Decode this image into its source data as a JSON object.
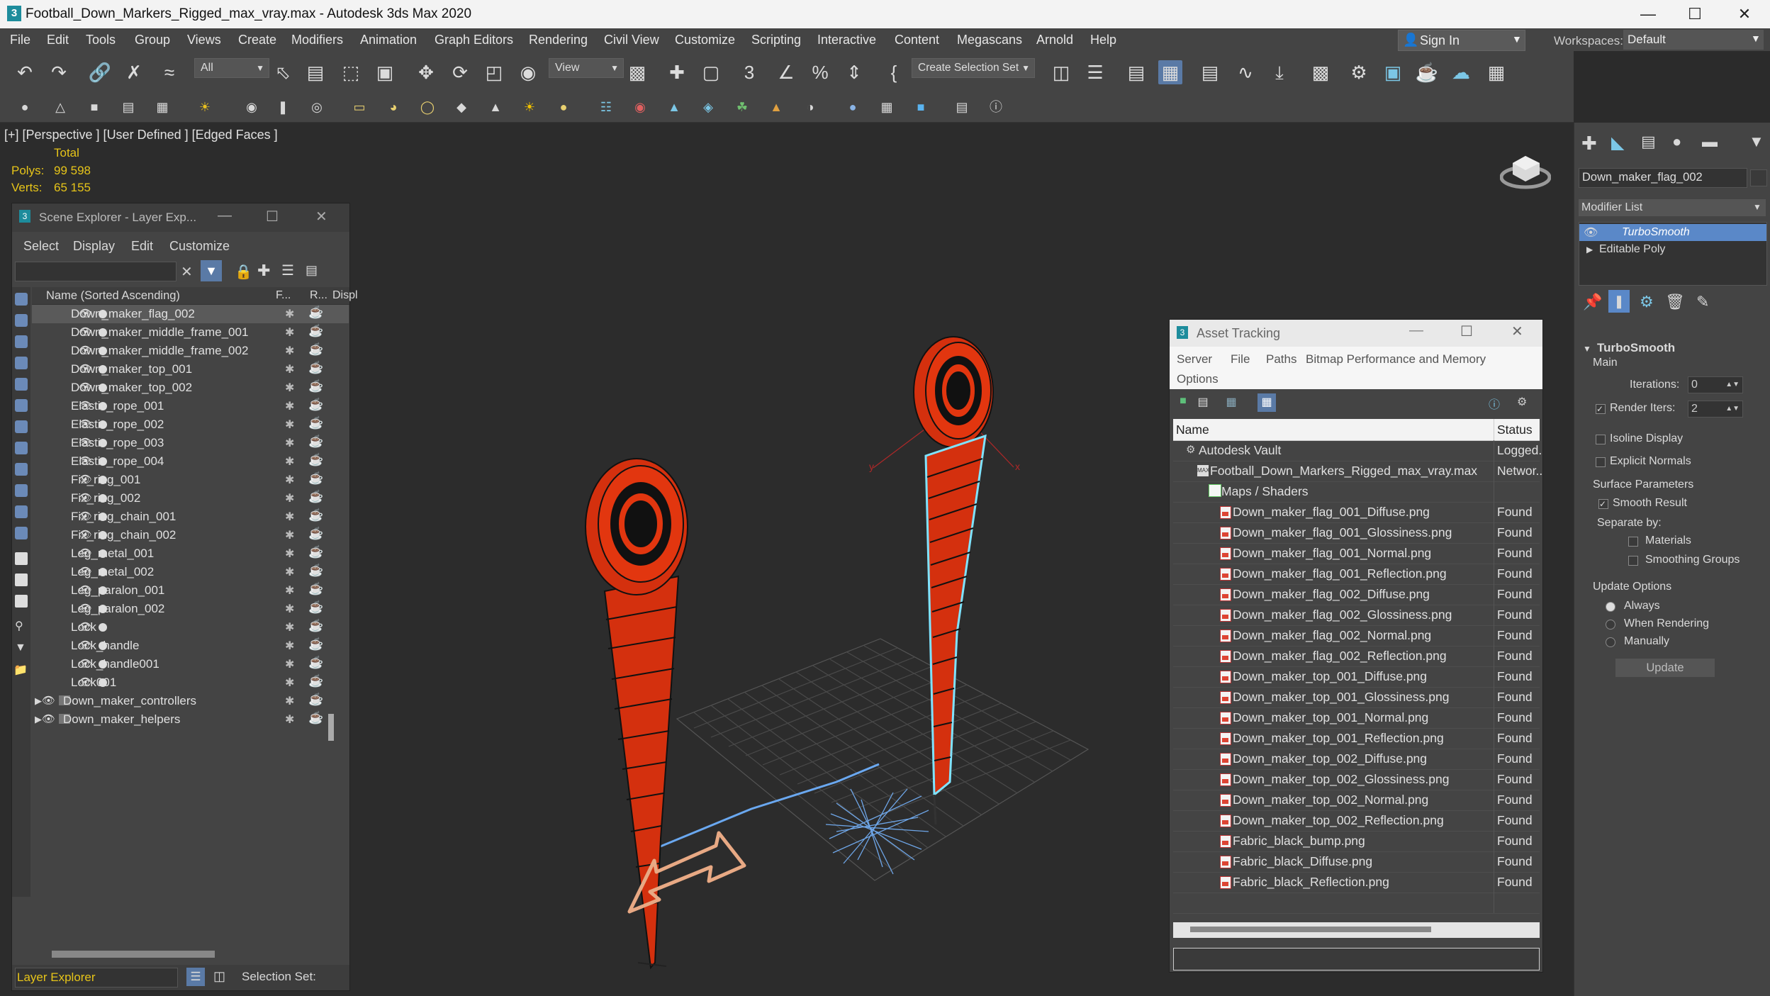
{
  "app": {
    "title": "Football_Down_Markers_Rigged_max_vray.max - Autodesk 3ds Max 2020",
    "icon": "3"
  },
  "menu": [
    "File",
    "Edit",
    "Tools",
    "Group",
    "Views",
    "Create",
    "Modifiers",
    "Animation",
    "Graph Editors",
    "Rendering",
    "Civil View",
    "Customize",
    "Scripting",
    "Interactive",
    "Content",
    "Megascans",
    "Arnold",
    "Help"
  ],
  "account": {
    "sign_in": "Sign In",
    "workspaces_label": "Workspaces:",
    "workspace": "Default"
  },
  "toolbar": {
    "filter": "All",
    "ref_coord": "View",
    "selection_set": "Create Selection Set"
  },
  "viewport": {
    "label": "[+] [Perspective ] [User Defined ] [Edged Faces ]",
    "stats_header": "Total",
    "polys_label": "Polys:",
    "polys": "99 598",
    "verts_label": "Verts:",
    "verts": "65 155",
    "colors": {
      "flag": "#d4300e",
      "target": "#e2360f",
      "grid": "#4a4a4a",
      "select": "#7fe3ff",
      "helper": "#e8a984"
    }
  },
  "scene_explorer": {
    "title": "Scene Explorer - Layer Exp...",
    "menu": [
      "Select",
      "Display",
      "Edit",
      "Customize"
    ],
    "col_name": "Name (Sorted Ascending)",
    "col_f": "F...",
    "col_r": "R...",
    "col_d": "Displ",
    "items": [
      {
        "name": "Down_maker_flag_002",
        "selected": true
      },
      {
        "name": "Down_maker_middle_frame_001"
      },
      {
        "name": "Down_maker_middle_frame_002"
      },
      {
        "name": "Down_maker_top_001"
      },
      {
        "name": "Down_maker_top_002"
      },
      {
        "name": "Elastic_rope_001"
      },
      {
        "name": "Elastic_rope_002"
      },
      {
        "name": "Elastic_rope_003"
      },
      {
        "name": "Elastic_rope_004"
      },
      {
        "name": "Fix_ring_001"
      },
      {
        "name": "Fix_ring_002"
      },
      {
        "name": "Fix_ring_chain_001"
      },
      {
        "name": "Fix_ring_chain_002"
      },
      {
        "name": "Leg_metal_001"
      },
      {
        "name": "Leg_metal_002"
      },
      {
        "name": "Leg_paralon_001"
      },
      {
        "name": "Leg_paralon_002"
      },
      {
        "name": "Lock"
      },
      {
        "name": "Lock_handle"
      },
      {
        "name": "Lock_handle001"
      },
      {
        "name": "Lock001"
      }
    ],
    "layers": [
      "Down_maker_controllers",
      "Down_maker_helpers"
    ],
    "footer_left": "Layer Explorer",
    "footer_right": "Selection Set:"
  },
  "asset_tracking": {
    "title": "Asset Tracking",
    "menu": [
      "Server",
      "File",
      "Paths",
      "Bitmap Performance and Memory",
      "Options"
    ],
    "col_name": "Name",
    "col_status": "Status",
    "vault": {
      "name": "Autodesk Vault",
      "status": "Logged..."
    },
    "file": {
      "name": "Football_Down_Markers_Rigged_max_vray.max",
      "status": "Networ..."
    },
    "folder": "Maps / Shaders",
    "maps": [
      {
        "name": "Down_maker_flag_001_Diffuse.png",
        "status": "Found"
      },
      {
        "name": "Down_maker_flag_001_Glossiness.png",
        "status": "Found"
      },
      {
        "name": "Down_maker_flag_001_Normal.png",
        "status": "Found"
      },
      {
        "name": "Down_maker_flag_001_Reflection.png",
        "status": "Found"
      },
      {
        "name": "Down_maker_flag_002_Diffuse.png",
        "status": "Found"
      },
      {
        "name": "Down_maker_flag_002_Glossiness.png",
        "status": "Found"
      },
      {
        "name": "Down_maker_flag_002_Normal.png",
        "status": "Found"
      },
      {
        "name": "Down_maker_flag_002_Reflection.png",
        "status": "Found"
      },
      {
        "name": "Down_maker_top_001_Diffuse.png",
        "status": "Found"
      },
      {
        "name": "Down_maker_top_001_Glossiness.png",
        "status": "Found"
      },
      {
        "name": "Down_maker_top_001_Normal.png",
        "status": "Found"
      },
      {
        "name": "Down_maker_top_001_Reflection.png",
        "status": "Found"
      },
      {
        "name": "Down_maker_top_002_Diffuse.png",
        "status": "Found"
      },
      {
        "name": "Down_maker_top_002_Glossiness.png",
        "status": "Found"
      },
      {
        "name": "Down_maker_top_002_Normal.png",
        "status": "Found"
      },
      {
        "name": "Down_maker_top_002_Reflection.png",
        "status": "Found"
      },
      {
        "name": "Fabric_black_bump.png",
        "status": "Found"
      },
      {
        "name": "Fabric_black_Diffuse.png",
        "status": "Found"
      },
      {
        "name": "Fabric_black_Reflection.png",
        "status": "Found"
      }
    ]
  },
  "command_panel": {
    "object_name": "Down_maker_flag_002",
    "modifier_list": "Modifier List",
    "stack": [
      "TurboSmooth",
      "Editable Poly"
    ],
    "rollout_title": "TurboSmooth",
    "main": "Main",
    "iterations_label": "Iterations:",
    "iterations": "0",
    "render_iters_label": "Render Iters:",
    "render_iters": "2",
    "isoline": "Isoline Display",
    "explicit_normals": "Explicit Normals",
    "surface_params": "Surface Parameters",
    "smooth_result": "Smooth Result",
    "separate_by": "Separate by:",
    "materials": "Materials",
    "smoothing_groups": "Smoothing Groups",
    "update_options": "Update Options",
    "always": "Always",
    "when_rendering": "When Rendering",
    "manually": "Manually",
    "update_button": "Update"
  }
}
